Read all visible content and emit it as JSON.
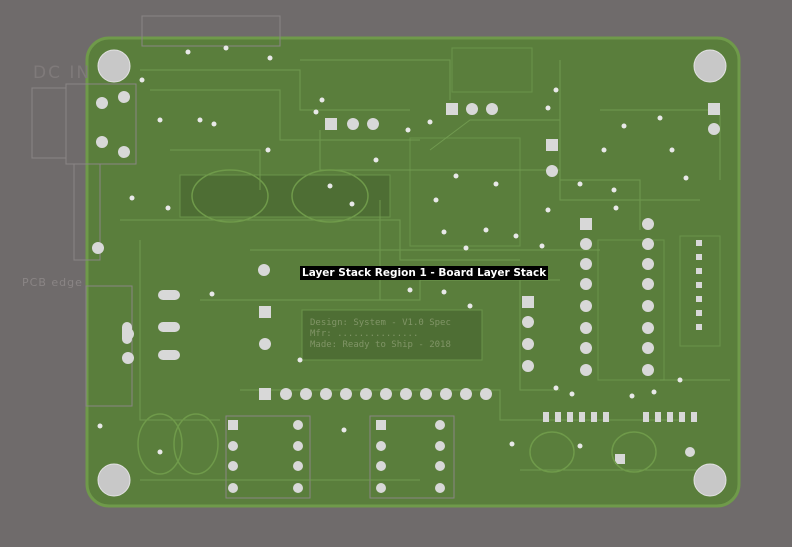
{
  "view": {
    "background_color": "#6f6b6b",
    "board_color": "#5a7e3c",
    "board_edge_color": "#6f9a4a",
    "trace_color": "#7aa55a",
    "pad_color": "#d8d8d8"
  },
  "labels": {
    "connector_silk": "DC IN",
    "pcb_edge": "PCB edge",
    "layer_stack_region": "Layer Stack Region 1 - Board Layer Stack",
    "silk_block": "Design: System - V1.0 Spec\nMfr: ...............\nMade: Ready to Ship - 2018"
  },
  "icons": {
    "mounting_hole": "circle-pad",
    "via": "small-dot"
  }
}
